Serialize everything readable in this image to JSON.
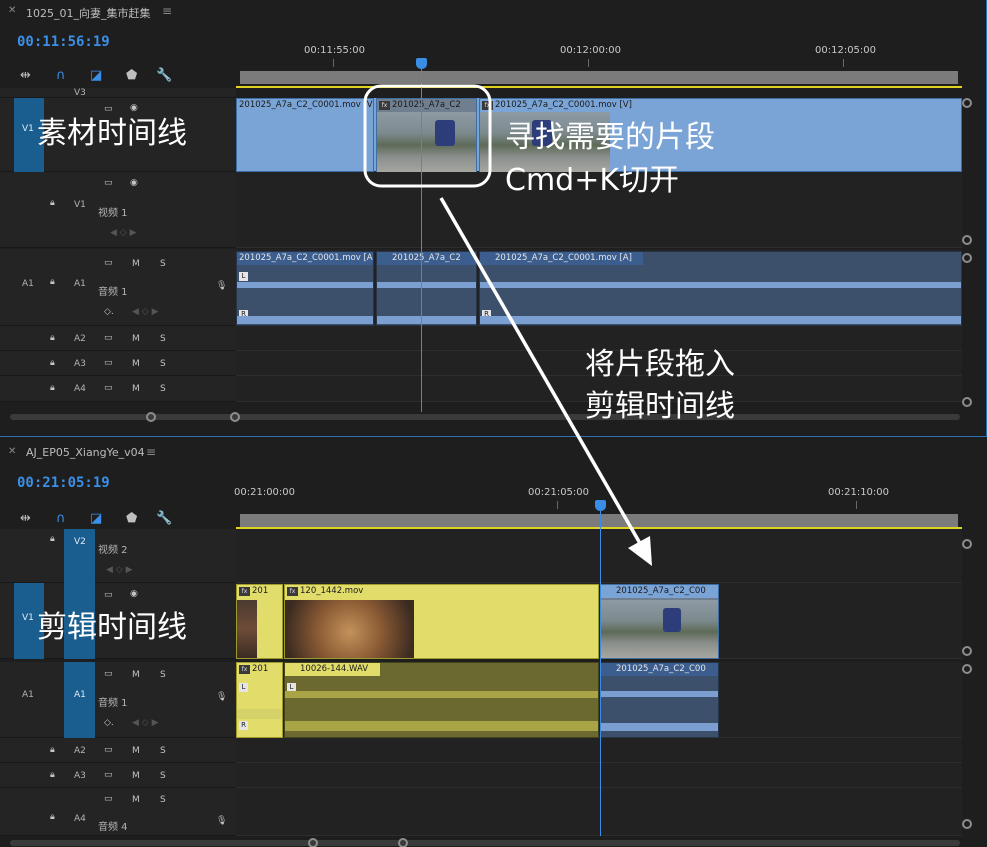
{
  "top": {
    "title": "1025_01_向妻_集市赶集",
    "timecode": "00:11:56:19",
    "ruler": [
      "00:11:55:00",
      "00:12:00:00",
      "00:12:05:00"
    ],
    "tracks": {
      "v3": "V3",
      "v1_src": "V1",
      "v1": "V1",
      "v1_name": "视频 1",
      "a1_src": "A1",
      "a1": "A1",
      "a1_name": "音频 1",
      "a2": "A2",
      "a3": "A3",
      "a4": "A4"
    },
    "clips_video": [
      "201025_A7a_C2_C0001.mov [V]",
      "201025_A7a_C2",
      "201025_A7a_C2_C0001.mov [V]"
    ],
    "clips_audio": [
      "201025_A7a_C2_C0001.mov [A]",
      "201025_A7a_C2",
      "201025_A7a_C2_C0001.mov [A]"
    ]
  },
  "bottom": {
    "title": "AJ_EP05_XiangYe_v04",
    "timecode": "00:21:05:19",
    "ruler": [
      "00:21:00:00",
      "00:21:05:00",
      "00:21:10:00"
    ],
    "tracks": {
      "v2": "V2",
      "v2_name": "视频 2",
      "v1_src": "V1",
      "a1_src": "A1",
      "a1": "A1",
      "a1_name": "音频 1",
      "a2": "A2",
      "a3": "A3",
      "a4": "A4",
      "a4_name": "音频 4"
    },
    "clips_video": [
      "201",
      "120_1442.mov",
      "201025_A7a_C2_C00"
    ],
    "clips_audio": [
      "201",
      "10026-144.WAV",
      "201025_A7a_C2_C00"
    ]
  },
  "labels": {
    "mute": "M",
    "solo": "S",
    "left": "L",
    "right": "R",
    "fx": "fx"
  },
  "annotations": {
    "source_timeline": "素材时间线",
    "find_clip_line1": "寻找需要的片段",
    "find_clip_line2": "Cmd+K切开",
    "drag_line1": "将片段拖入",
    "drag_line2": "剪辑时间线",
    "edit_timeline": "剪辑时间线"
  },
  "icons": [
    "close-icon",
    "menu-icon",
    "snap-icon",
    "magnet-icon",
    "linked-selection-icon",
    "marker-icon",
    "wrench-icon",
    "track-output-icon",
    "eye-icon",
    "lock-icon",
    "microphone-icon",
    "keyframe-icon",
    "playhead-icon"
  ],
  "colors": {
    "timecode": "#3b8fe8",
    "video_clip_source": "#7ba4d6",
    "video_clip_edit": "#e2dd6b",
    "audio_clip": "#3c4f6b",
    "audio_clip_edit": "#6b6930",
    "active_track": "#1a5d8f",
    "work_area": "#e0d21f"
  }
}
